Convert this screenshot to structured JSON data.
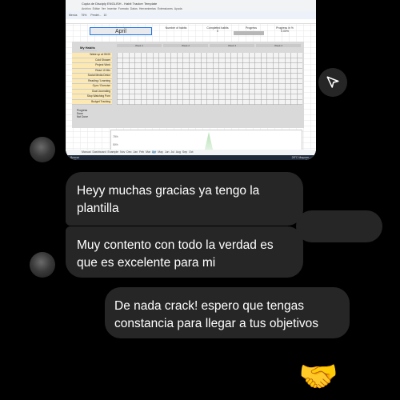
{
  "shared_image": {
    "doc_title": "Copia de Disciply ENGLISH - Habit Tracker Template",
    "menu": [
      "Archivo",
      "Editar",
      "Ver",
      "Insertar",
      "Formato",
      "Datos",
      "Herramientas",
      "Extensiones",
      "Ayuda"
    ],
    "toolbar_search": "Menús",
    "zoom": "75%",
    "font": "Predet...",
    "font_size": "10",
    "month": "April",
    "headers": {
      "habits": "Number of habits",
      "completed": "Completed habits",
      "completed_value": "0",
      "progress": "Progress",
      "progress_pct": "Progress in %",
      "progress_pct_value": "0.00%"
    },
    "my_habits_label": "My Habits",
    "weeks": [
      "Week 1",
      "Week 2",
      "Week 3",
      "Week 4"
    ],
    "habits": [
      "Wake up at 05:00",
      "Cold Shower",
      "Project Work",
      "Read 10 Min",
      "Social Media Detox",
      "Reading / Learning",
      "Gym / Exercise",
      "Goal Journaling",
      "Stop Watching Porn",
      "Budget Tracking"
    ],
    "summary_rows": [
      "Progress",
      "Done",
      "Not Done"
    ],
    "chart_ticks": [
      "75%",
      "50%"
    ],
    "tabs": [
      "Manual",
      "Dashboard",
      "Example",
      "Nov",
      "Dec",
      "Jan",
      "Feb",
      "Mar",
      "Apr",
      "May",
      "Jun",
      "Jul",
      "Aug",
      "Sep",
      "Oct"
    ],
    "taskbar_search": "Buscar",
    "weather": "28°C Mayorm..."
  },
  "messages": [
    {
      "id": "m1",
      "text": "Heyy muchas gracias ya tengo la plantilla",
      "sender": "other"
    },
    {
      "id": "m2",
      "text": "Muy contento con todo la verdad es que es excelente para mi",
      "sender": "other"
    },
    {
      "id": "m3",
      "text": "De nada crack! espero que tengas constancia para llegar a tus objetivos",
      "sender": "me"
    }
  ],
  "reaction_emoji": "🤝",
  "icons": {
    "share": "send-icon"
  }
}
